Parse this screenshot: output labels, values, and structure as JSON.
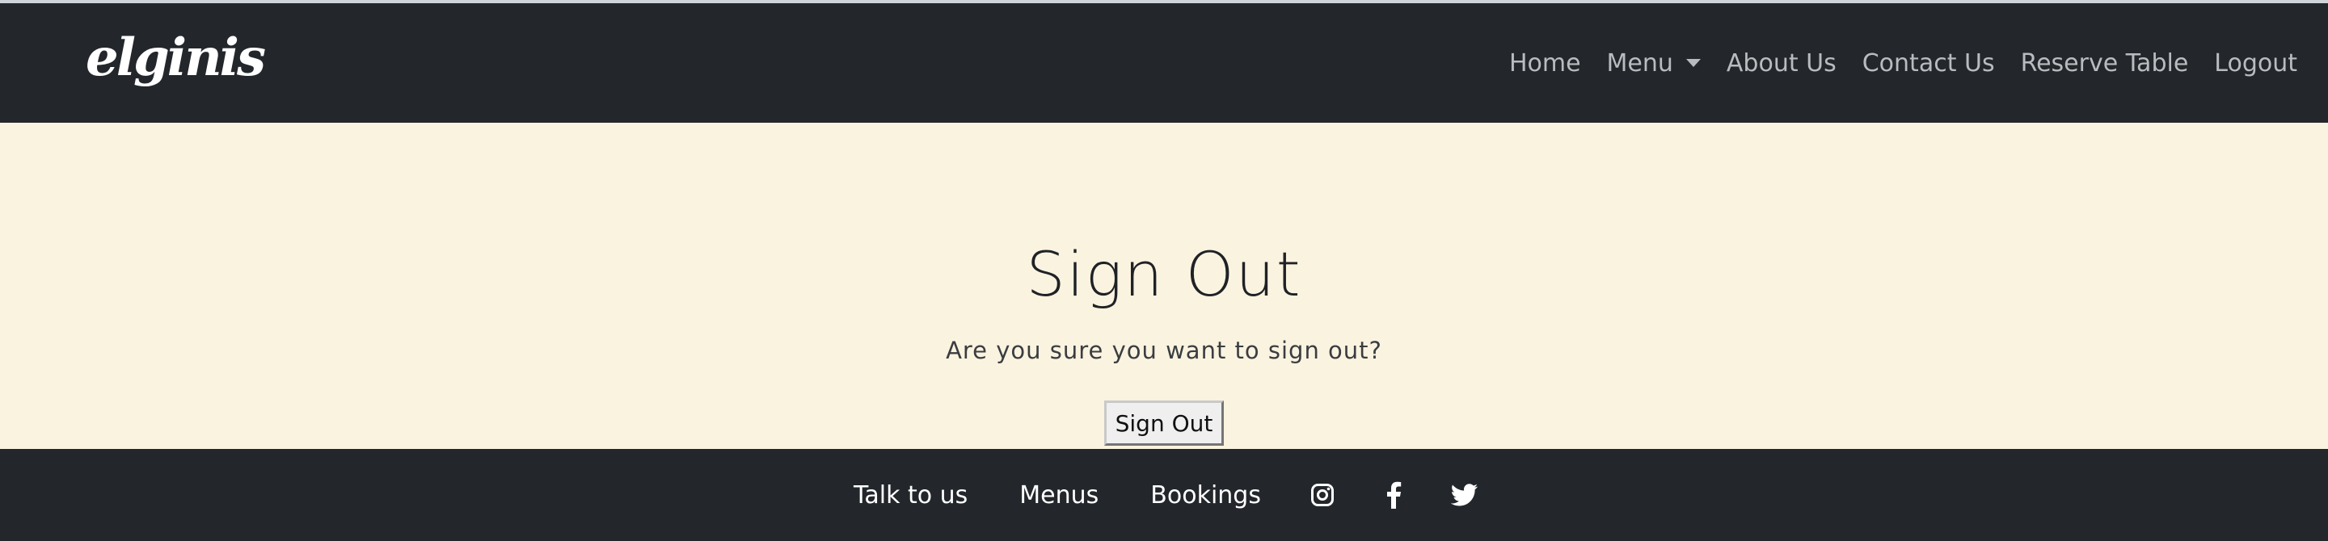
{
  "brand": {
    "logo_text": "elginis"
  },
  "nav": {
    "items": [
      {
        "label": "Home"
      },
      {
        "label": "Menu",
        "dropdown": true
      },
      {
        "label": "About Us"
      },
      {
        "label": "Contact Us"
      },
      {
        "label": "Reserve Table"
      },
      {
        "label": "Logout"
      }
    ]
  },
  "main": {
    "title": "Sign Out",
    "subtitle": "Are you sure you want to sign out?",
    "button_label": "Sign Out"
  },
  "footer": {
    "links": [
      {
        "label": "Talk to us"
      },
      {
        "label": "Menus"
      },
      {
        "label": "Bookings"
      }
    ],
    "social_icons": [
      "instagram-icon",
      "facebook-icon",
      "twitter-icon"
    ]
  },
  "colors": {
    "navbar_bg": "#23272b",
    "page_bg": "#faf3e0",
    "nav_text": "#b9bcbf",
    "footer_text": "#ffffff"
  }
}
